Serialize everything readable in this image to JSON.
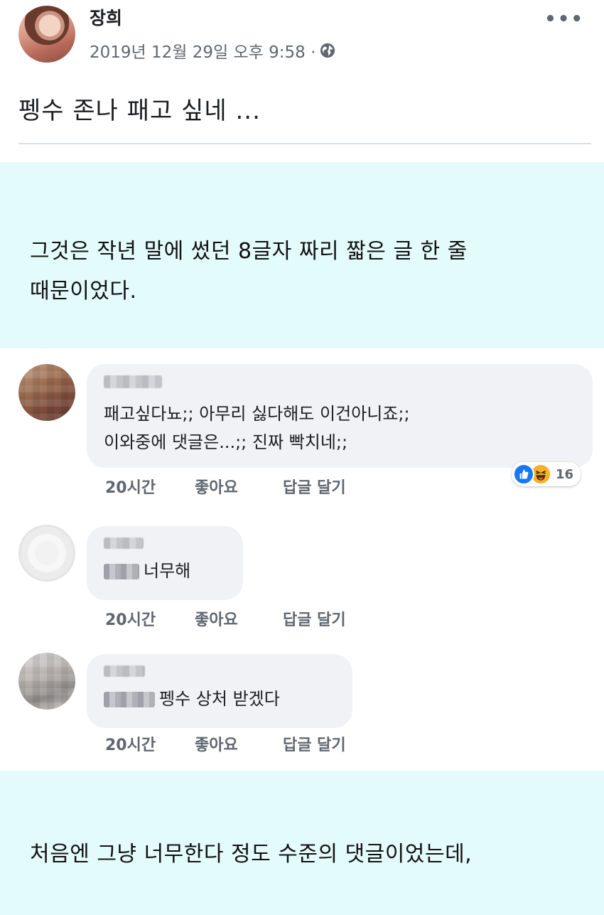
{
  "post": {
    "author": "장희",
    "timestamp": "2019년 12월 29일 오후 9:58 ·",
    "privacy_icon": "globe-icon",
    "more_icon": "more-options-icon",
    "text": "펭수 존나 패고 싶네 ..."
  },
  "captions": {
    "first_line1": "그것은 작년 말에 썼던 8글자 짜리 짧은 글 한 줄",
    "first_line2": "때문이었다.",
    "second": "처음엔 그냥 너무한다 정도 수준의 댓글이었는데,"
  },
  "comments": [
    {
      "text_line1": "패고싶다뇨;; 아무리 싫다해도 이건아니죠;;",
      "text_line2": "이와중에 댓글은...;; 진짜 빡치네;;",
      "time": "20시간",
      "like": "좋아요",
      "reply": "답글 달기",
      "reaction_count": "16"
    },
    {
      "text": "너무해",
      "time": "20시간",
      "like": "좋아요",
      "reply": "답글 달기"
    },
    {
      "text": "펭수 상처 받겠다",
      "time": "20시간",
      "like": "좋아요",
      "reply": "답글 달기"
    }
  ],
  "colors": {
    "caption_bg": "#e4fbfb",
    "bubble_bg": "#f0f2f5",
    "meta_text": "#606770",
    "like_blue": "#1877f2",
    "haha_yellow": "#f7b125"
  }
}
